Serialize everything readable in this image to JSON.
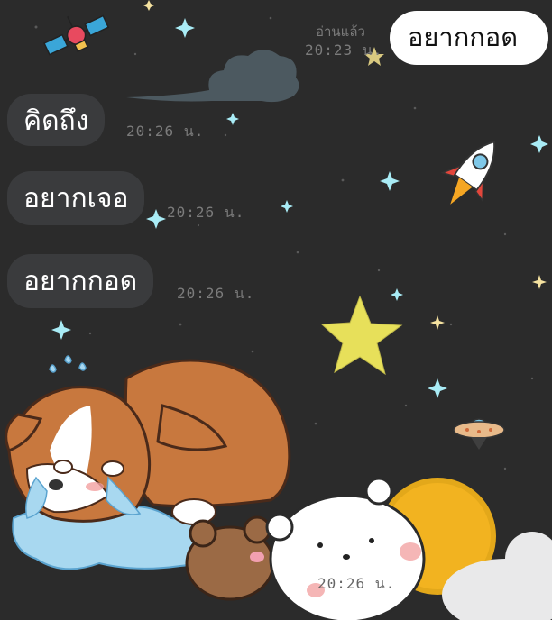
{
  "chat": {
    "outgoing": [
      {
        "text": "อยากกอด",
        "read_label": "อ่านแล้ว",
        "time": "20:23 น."
      }
    ],
    "incoming": [
      {
        "text": "คิดถึง",
        "time": "20:26 น."
      },
      {
        "text": "อยากเจอ",
        "time": "20:26 น."
      },
      {
        "text": "อยากกอด",
        "time": "20:26 น."
      }
    ],
    "sticker": {
      "time": "20:26 น.",
      "description": "crying corgi puppy with bears and sun"
    }
  },
  "colors": {
    "background": "#2b2b2b",
    "bubble_incoming": "#3a3b3d",
    "bubble_outgoing": "#ffffff",
    "meta_text": "#7b7b7b",
    "star_yellow": "#e7e05a",
    "star_blue": "#a9ecf6"
  },
  "icons": [
    "satellite-icon",
    "cloud-icon",
    "rocket-icon",
    "star-icon",
    "ufo-icon",
    "sparkle-icon"
  ]
}
